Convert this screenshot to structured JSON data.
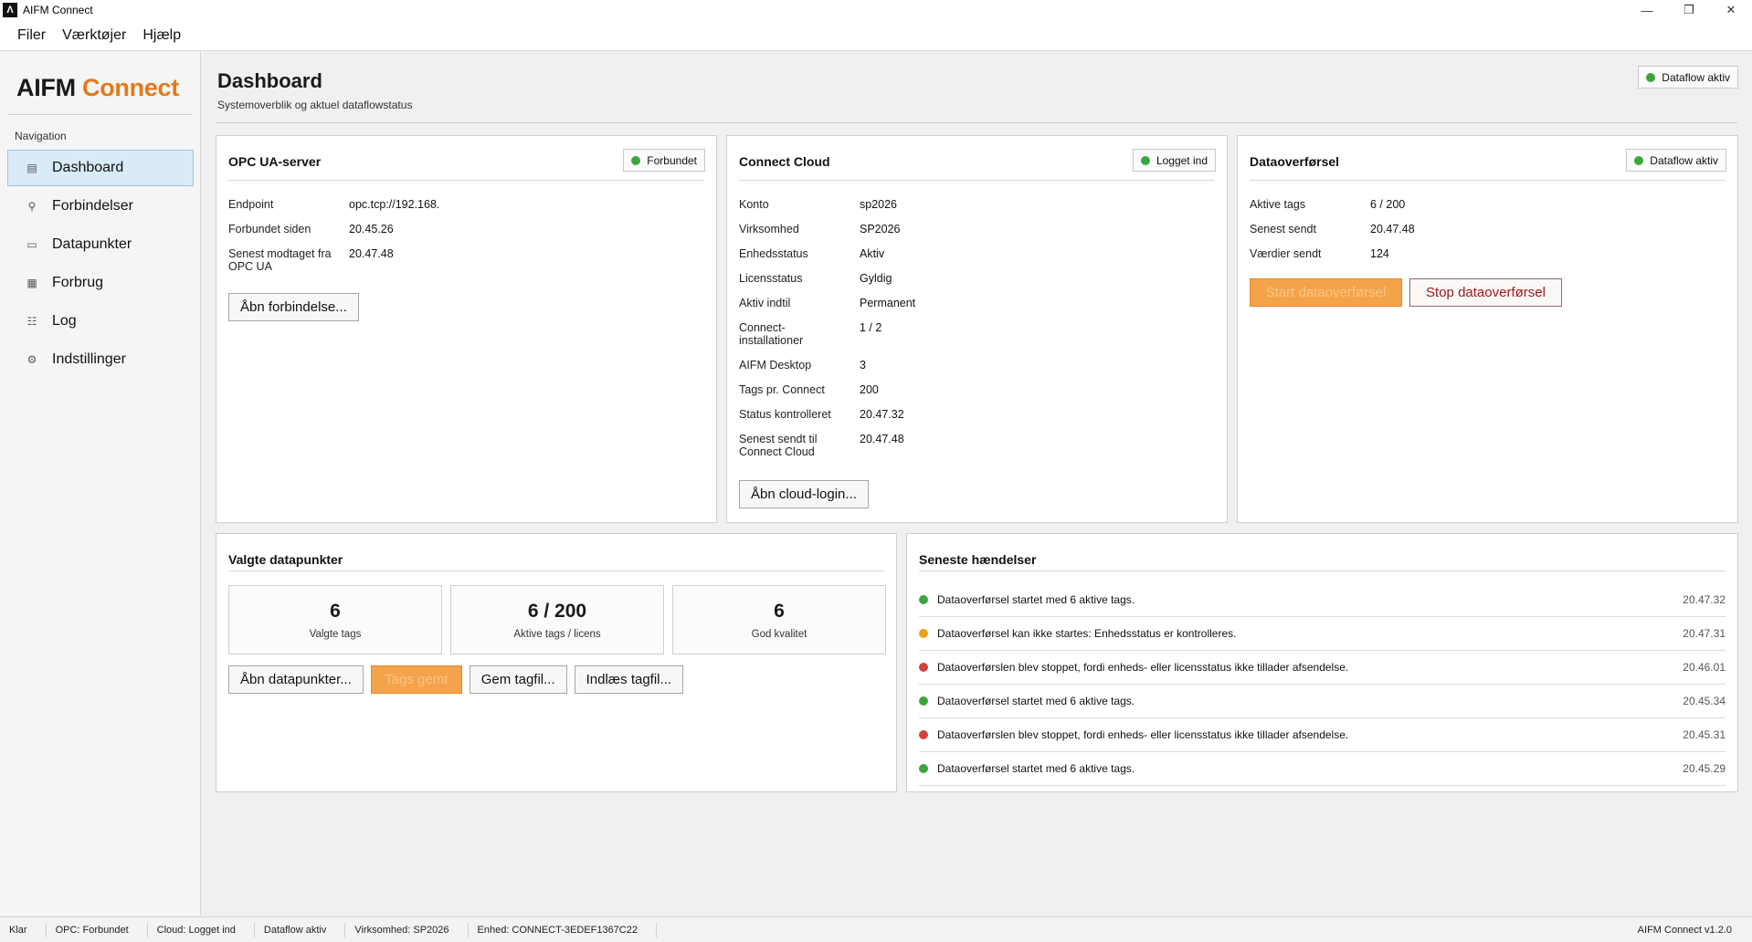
{
  "window": {
    "title": "AIFM Connect",
    "icon_glyph": "Λ",
    "minimize": "—",
    "restore": "❐",
    "close": "✕"
  },
  "menu": [
    "Filer",
    "Værktøjer",
    "Hjælp"
  ],
  "sidebar": {
    "brand_part1": "AIFM",
    "brand_part2": "Connect",
    "nav_heading": "Navigation",
    "items": [
      {
        "label": "Dashboard",
        "icon": "▤",
        "icon_name": "dashboard-icon"
      },
      {
        "label": "Forbindelser",
        "icon": "⚲",
        "icon_name": "plug-icon"
      },
      {
        "label": "Datapunkter",
        "icon": "▭",
        "icon_name": "tag-icon"
      },
      {
        "label": "Forbrug",
        "icon": "▦",
        "icon_name": "usage-icon"
      },
      {
        "label": "Log",
        "icon": "☷",
        "icon_name": "log-icon"
      },
      {
        "label": "Indstillinger",
        "icon": "⚙",
        "icon_name": "gear-icon"
      }
    ],
    "active_index": 0
  },
  "header": {
    "title": "Dashboard",
    "subtitle": "Systemoverblik og aktuel dataflowstatus",
    "badge": "Dataflow aktiv"
  },
  "opc": {
    "title": "OPC UA-server",
    "badge": "Forbundet",
    "rows": [
      {
        "key": "Endpoint",
        "value": "opc.tcp://192.168."
      },
      {
        "key": "Forbundet siden",
        "value": "20.45.26"
      },
      {
        "key": "Senest modtaget fra OPC UA",
        "value": "20.47.48"
      }
    ],
    "button": "Åbn forbindelse..."
  },
  "cloud": {
    "title": "Connect Cloud",
    "badge": "Logget ind",
    "rows": [
      {
        "key": "Konto",
        "value": "sp2026"
      },
      {
        "key": "Virksomhed",
        "value": "SP2026"
      },
      {
        "key": "Enhedsstatus",
        "value": "Aktiv"
      },
      {
        "key": "Licensstatus",
        "value": "Gyldig"
      },
      {
        "key": "Aktiv indtil",
        "value": "Permanent"
      },
      {
        "key": "Connect-installationer",
        "value": "1 / 2"
      },
      {
        "key": "AIFM Desktop",
        "value": "3"
      },
      {
        "key": "Tags pr. Connect",
        "value": "200"
      },
      {
        "key": "Status kontrolleret",
        "value": "20.47.32"
      },
      {
        "key": "Senest sendt til Connect Cloud",
        "value": "20.47.48"
      }
    ],
    "button": "Åbn cloud-login..."
  },
  "transfer": {
    "title": "Dataoverførsel",
    "badge": "Dataflow aktiv",
    "rows": [
      {
        "key": "Aktive tags",
        "value": "6 / 200"
      },
      {
        "key": "Senest sendt",
        "value": "20.47.48"
      },
      {
        "key": "Værdier sendt",
        "value": "124"
      }
    ],
    "start_button": "Start dataoverførsel",
    "stop_button": "Stop dataoverførsel"
  },
  "datapoints": {
    "title": "Valgte datapunkter",
    "stats": [
      {
        "value": "6",
        "label": "Valgte tags"
      },
      {
        "value": "6 / 200",
        "label": "Aktive tags / licens"
      },
      {
        "value": "6",
        "label": "God kvalitet"
      }
    ],
    "buttons": {
      "open": "Åbn datapunkter...",
      "saved": "Tags gemt",
      "save_file": "Gem tagfil...",
      "load_file": "Indlæs tagfil..."
    }
  },
  "events": {
    "title": "Seneste hændelser",
    "items": [
      {
        "text": "Dataoverførsel startet med 6 aktive tags.",
        "time": "20.47.32",
        "level": "green"
      },
      {
        "text": "Dataoverførsel kan ikke startes: Enhedsstatus er kontrolleres.",
        "time": "20.47.31",
        "level": "orange"
      },
      {
        "text": "Dataoverførslen blev stoppet, fordi enheds- eller licensstatus ikke tillader afsendelse.",
        "time": "20.46.01",
        "level": "red"
      },
      {
        "text": "Dataoverførsel startet med 6 aktive tags.",
        "time": "20.45.34",
        "level": "green"
      },
      {
        "text": "Dataoverførslen blev stoppet, fordi enheds- eller licensstatus ikke tillader afsendelse.",
        "time": "20.45.31",
        "level": "red"
      },
      {
        "text": "Dataoverførsel startet med 6 aktive tags.",
        "time": "20.45.29",
        "level": "green"
      }
    ]
  },
  "statusbar": {
    "items": [
      "Klar",
      "OPC: Forbundet",
      "Cloud: Logget ind",
      "Dataflow aktiv",
      "Virksomhed: SP2026",
      "Enhed: CONNECT-3EDEF1367C22"
    ],
    "version": "AIFM Connect v1.2.0"
  },
  "colors": {
    "accent": "#e07a1c",
    "active_nav_bg": "#d9eaf8",
    "status_green": "#3da53d",
    "status_orange": "#e6a21a",
    "status_red": "#d34040"
  }
}
